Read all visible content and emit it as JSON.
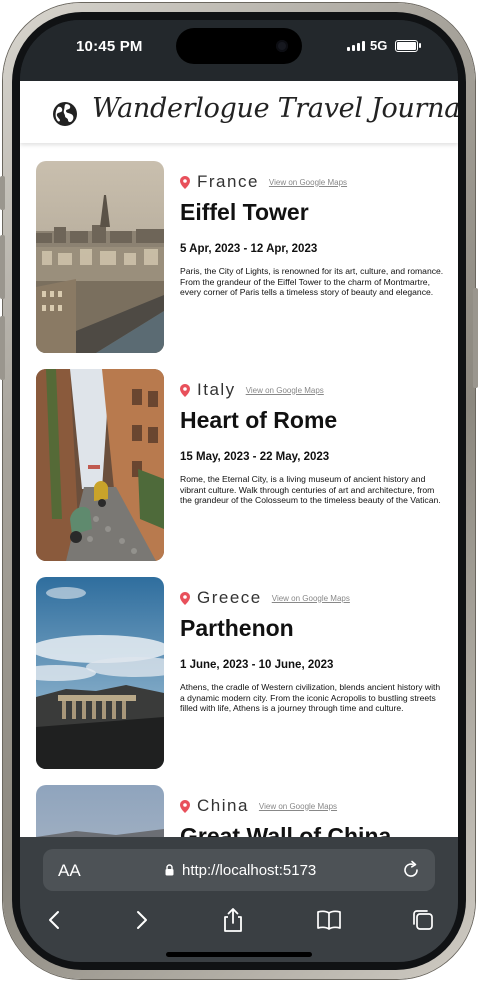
{
  "status": {
    "time": "10:45 PM",
    "network": "5G"
  },
  "app": {
    "title": "Wanderlogue Travel Journal"
  },
  "entries": [
    {
      "country": "France",
      "map_link": "View on Google Maps",
      "title": "Eiffel Tower",
      "dates": "5 Apr, 2023 - 12 Apr, 2023",
      "description": "Paris, the City of Lights, is renowned for its art, culture, and romance. From the grandeur of the Eiffel Tower to the charm of Montmartre, every corner of Paris tells a timeless story of beauty and elegance."
    },
    {
      "country": "Italy",
      "map_link": "View on Google Maps",
      "title": "Heart of Rome",
      "dates": "15 May, 2023 - 22 May, 2023",
      "description": "Rome, the Eternal City, is a living museum of ancient history and vibrant culture. Walk through centuries of art and architecture, from the grandeur of the Colosseum to the timeless beauty of the Vatican."
    },
    {
      "country": "Greece",
      "map_link": "View on Google Maps",
      "title": "Parthenon",
      "dates": "1 June, 2023 - 10 June, 2023",
      "description": "Athens, the cradle of Western civilization, blends ancient history with a dynamic modern city. From the iconic Acropolis to bustling streets filled with life, Athens is a journey through time and culture."
    },
    {
      "country": "China",
      "map_link": "View on Google Maps",
      "title": "Great Wall of China",
      "dates": "",
      "description": ""
    }
  ],
  "browser": {
    "text_size_label": "AA",
    "url": "http://localhost:5173"
  },
  "icons": {
    "globe": "globe-icon",
    "pin": "map-pin-icon",
    "lock": "lock-icon",
    "reload": "reload-icon",
    "back": "back-arrow-icon",
    "forward": "forward-arrow-icon",
    "share": "share-icon",
    "bookmarks": "book-icon",
    "tabs": "tabs-icon"
  },
  "colors": {
    "pin": "#e8505b",
    "browser_bar": "#3a3f43",
    "url_field": "#4d5256"
  }
}
